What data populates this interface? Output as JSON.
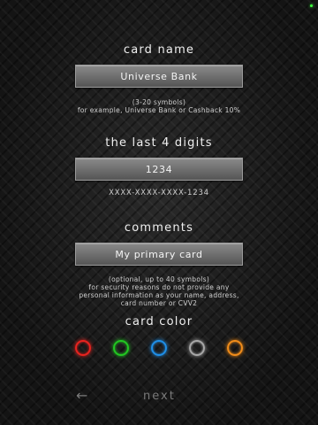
{
  "name_section": {
    "label": "card name",
    "value": "Universe Bank",
    "hint_line1": "(3-20 symbols)",
    "hint_line2": "for example, Universe Bank or Cashback 10%"
  },
  "digits_section": {
    "label": "the last 4 digits",
    "value": "1234",
    "mask": "XXXX-XXXX-XXXX-1234"
  },
  "comments_section": {
    "label": "comments",
    "value": "My primary card",
    "hint_lines": [
      "(optional, up to 40 symbols)",
      "for security reasons do not provide any",
      "personal information as your name, address,",
      "card number or CVV2"
    ]
  },
  "color_section": {
    "label": "card color",
    "swatches": [
      {
        "name": "red",
        "color": "#e8231f"
      },
      {
        "name": "green",
        "color": "#22c722"
      },
      {
        "name": "blue",
        "color": "#1f8fe8"
      },
      {
        "name": "grey",
        "color": "#a8a8a8"
      },
      {
        "name": "orange",
        "color": "#f08c1a"
      }
    ]
  },
  "nav": {
    "back_icon": "←",
    "next_label": "next"
  },
  "colors": {
    "status_dot": "#3cff3c"
  }
}
